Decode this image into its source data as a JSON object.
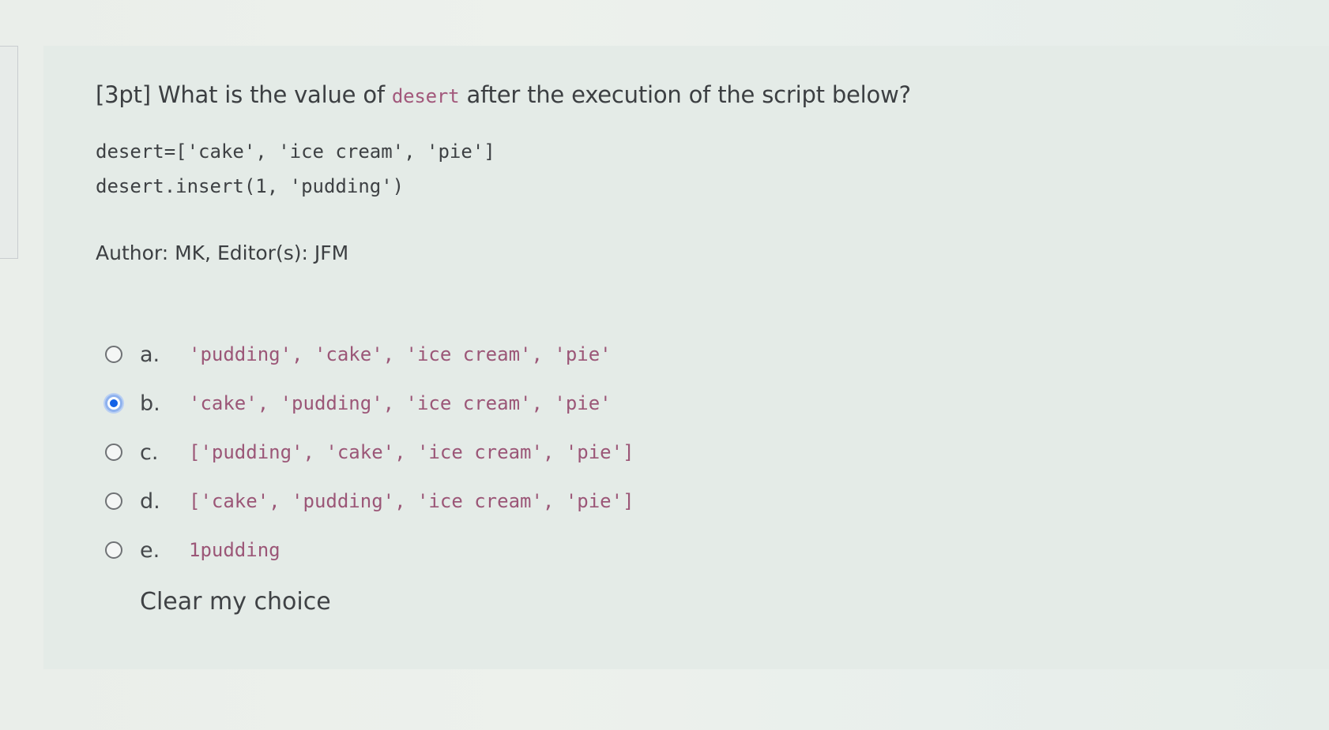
{
  "question": {
    "points": "[3pt]",
    "text_before": "What is the value of",
    "variable": "desert",
    "text_after": "after the execution of the script below?",
    "code_lines": [
      "desert=['cake', 'ice cream', 'pie']",
      "desert.insert(1, 'pudding')"
    ],
    "author_line": "Author: MK, Editor(s): JFM"
  },
  "answers": [
    {
      "letter": "a.",
      "text": "'pudding', 'cake', 'ice cream', 'pie'",
      "selected": false
    },
    {
      "letter": "b.",
      "text": "'cake', 'pudding', 'ice cream', 'pie'",
      "selected": true
    },
    {
      "letter": "c.",
      "text": "['pudding', 'cake', 'ice cream', 'pie']",
      "selected": false
    },
    {
      "letter": "d.",
      "text": "['cake', 'pudding', 'ice cream', 'pie']",
      "selected": false
    },
    {
      "letter": "e.",
      "text": "1pudding",
      "selected": false
    }
  ],
  "clear_choice_label": "Clear my choice",
  "colors": {
    "code_text": "#9b5677",
    "radio_selected": "#1261e6",
    "body_text": "#3c3f42"
  }
}
